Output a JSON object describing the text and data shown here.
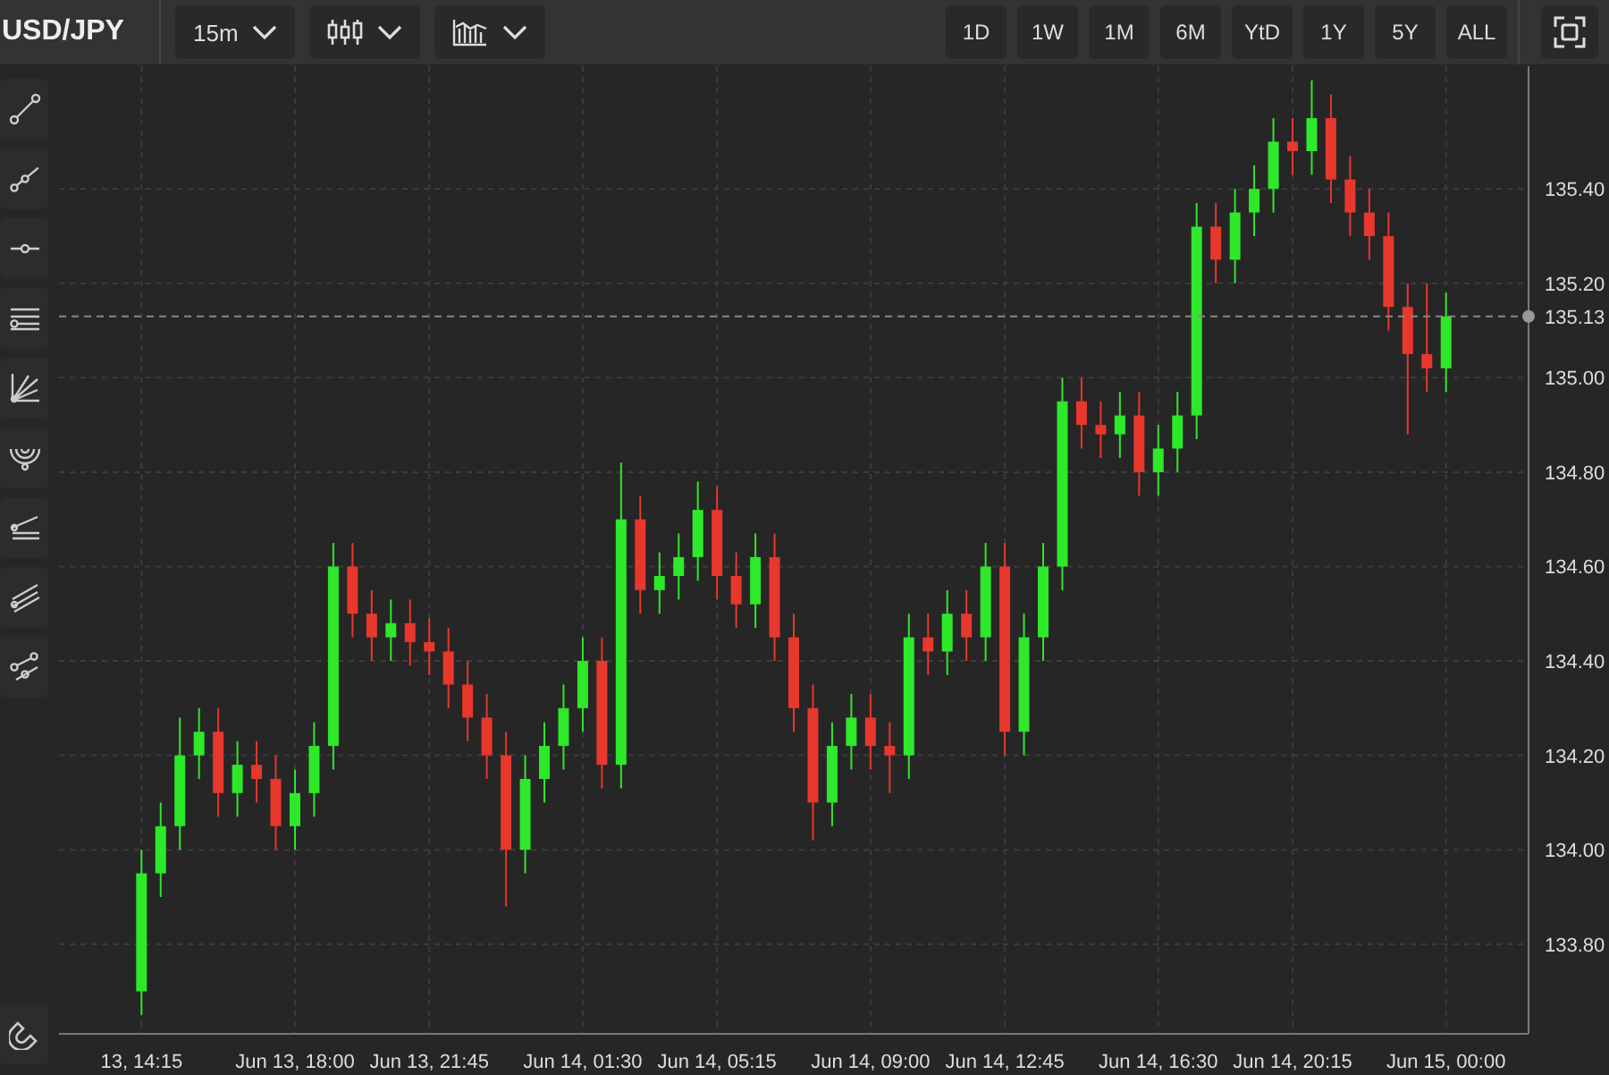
{
  "toolbar": {
    "symbol": "USD/JPY",
    "interval": "15m",
    "ranges": [
      "1D",
      "1W",
      "1M",
      "6M",
      "YtD",
      "1Y",
      "5Y",
      "ALL"
    ]
  },
  "chart": {
    "chart_data": {
      "type": "candlestick",
      "ylim": [
        133.61,
        135.66
      ],
      "yticks": [
        {
          "value": 133.8,
          "label": "133.80"
        },
        {
          "value": 134.0,
          "label": "134.00"
        },
        {
          "value": 134.2,
          "label": "134.20"
        },
        {
          "value": 134.4,
          "label": "134.40"
        },
        {
          "value": 134.6,
          "label": "134.60"
        },
        {
          "value": 134.8,
          "label": "134.80"
        },
        {
          "value": 135.0,
          "label": "135.00"
        },
        {
          "value": 135.2,
          "label": "135.20"
        },
        {
          "value": 135.4,
          "label": "135.40"
        }
      ],
      "categories": [
        "13, 14:15",
        null,
        null,
        null,
        null,
        null,
        null,
        null,
        "Jun 13, 18:00",
        null,
        null,
        null,
        null,
        null,
        null,
        "Jun 13, 21:45",
        null,
        null,
        null,
        null,
        null,
        null,
        null,
        "Jun 14, 01:30",
        null,
        null,
        null,
        null,
        null,
        null,
        "Jun 14, 05:15",
        null,
        null,
        null,
        null,
        null,
        null,
        null,
        "Jun 14, 09:00",
        null,
        null,
        null,
        null,
        null,
        null,
        "Jun 14, 12:45",
        null,
        null,
        null,
        null,
        null,
        null,
        null,
        "Jun 14, 16:30",
        null,
        null,
        null,
        null,
        null,
        null,
        "Jun 14, 20:15",
        null,
        null,
        null,
        null,
        null,
        null,
        null,
        "Jun 15, 00:00"
      ],
      "ohlc": [
        [
          133.7,
          134.0,
          133.65,
          133.95
        ],
        [
          133.95,
          134.1,
          133.9,
          134.05
        ],
        [
          134.05,
          134.28,
          134.0,
          134.2
        ],
        [
          134.2,
          134.3,
          134.15,
          134.25
        ],
        [
          134.25,
          134.3,
          134.07,
          134.12
        ],
        [
          134.12,
          134.23,
          134.07,
          134.18
        ],
        [
          134.18,
          134.23,
          134.1,
          134.15
        ],
        [
          134.15,
          134.2,
          134.0,
          134.05
        ],
        [
          134.05,
          134.17,
          134.0,
          134.12
        ],
        [
          134.12,
          134.27,
          134.07,
          134.22
        ],
        [
          134.22,
          134.65,
          134.17,
          134.6
        ],
        [
          134.6,
          134.65,
          134.45,
          134.5
        ],
        [
          134.5,
          134.55,
          134.4,
          134.45
        ],
        [
          134.45,
          134.53,
          134.4,
          134.48
        ],
        [
          134.48,
          134.53,
          134.39,
          134.44
        ],
        [
          134.44,
          134.49,
          134.37,
          134.42
        ],
        [
          134.42,
          134.47,
          134.3,
          134.35
        ],
        [
          134.35,
          134.4,
          134.23,
          134.28
        ],
        [
          134.28,
          134.33,
          134.15,
          134.2
        ],
        [
          134.2,
          134.25,
          133.88,
          134.0
        ],
        [
          134.0,
          134.2,
          133.95,
          134.15
        ],
        [
          134.15,
          134.27,
          134.1,
          134.22
        ],
        [
          134.22,
          134.35,
          134.17,
          134.3
        ],
        [
          134.3,
          134.45,
          134.25,
          134.4
        ],
        [
          134.4,
          134.45,
          134.13,
          134.18
        ],
        [
          134.18,
          134.82,
          134.13,
          134.7
        ],
        [
          134.7,
          134.75,
          134.5,
          134.55
        ],
        [
          134.55,
          134.63,
          134.5,
          134.58
        ],
        [
          134.58,
          134.67,
          134.53,
          134.62
        ],
        [
          134.62,
          134.78,
          134.57,
          134.72
        ],
        [
          134.72,
          134.77,
          134.53,
          134.58
        ],
        [
          134.58,
          134.63,
          134.47,
          134.52
        ],
        [
          134.52,
          134.67,
          134.47,
          134.62
        ],
        [
          134.62,
          134.67,
          134.4,
          134.45
        ],
        [
          134.45,
          134.5,
          134.25,
          134.3
        ],
        [
          134.3,
          134.35,
          134.02,
          134.1
        ],
        [
          134.1,
          134.27,
          134.05,
          134.22
        ],
        [
          134.22,
          134.33,
          134.17,
          134.28
        ],
        [
          134.28,
          134.33,
          134.17,
          134.22
        ],
        [
          134.22,
          134.27,
          134.12,
          134.2
        ],
        [
          134.2,
          134.5,
          134.15,
          134.45
        ],
        [
          134.45,
          134.5,
          134.37,
          134.42
        ],
        [
          134.42,
          134.55,
          134.37,
          134.5
        ],
        [
          134.5,
          134.55,
          134.4,
          134.45
        ],
        [
          134.45,
          134.65,
          134.4,
          134.6
        ],
        [
          134.6,
          134.65,
          134.2,
          134.25
        ],
        [
          134.25,
          134.5,
          134.2,
          134.45
        ],
        [
          134.45,
          134.65,
          134.4,
          134.6
        ],
        [
          134.6,
          135.0,
          134.55,
          134.95
        ],
        [
          134.95,
          135.0,
          134.85,
          134.9
        ],
        [
          134.9,
          134.95,
          134.83,
          134.88
        ],
        [
          134.88,
          134.97,
          134.83,
          134.92
        ],
        [
          134.92,
          134.97,
          134.75,
          134.8
        ],
        [
          134.8,
          134.9,
          134.75,
          134.85
        ],
        [
          134.85,
          134.97,
          134.8,
          134.92
        ],
        [
          134.92,
          135.37,
          134.87,
          135.32
        ],
        [
          135.32,
          135.37,
          135.2,
          135.25
        ],
        [
          135.25,
          135.4,
          135.2,
          135.35
        ],
        [
          135.35,
          135.45,
          135.3,
          135.4
        ],
        [
          135.4,
          135.55,
          135.35,
          135.5
        ],
        [
          135.5,
          135.55,
          135.43,
          135.48
        ],
        [
          135.48,
          135.63,
          135.43,
          135.55
        ],
        [
          135.55,
          135.6,
          135.37,
          135.42
        ],
        [
          135.42,
          135.47,
          135.3,
          135.35
        ],
        [
          135.35,
          135.4,
          135.25,
          135.3
        ],
        [
          135.3,
          135.35,
          135.1,
          135.15
        ],
        [
          135.15,
          135.2,
          134.88,
          135.05
        ],
        [
          135.05,
          135.2,
          134.97,
          135.02
        ],
        [
          135.02,
          135.18,
          134.97,
          135.13
        ]
      ],
      "grid": true,
      "ref_lines": [
        {
          "axis": "y",
          "value": 135.13,
          "label": "135.13"
        }
      ]
    }
  }
}
